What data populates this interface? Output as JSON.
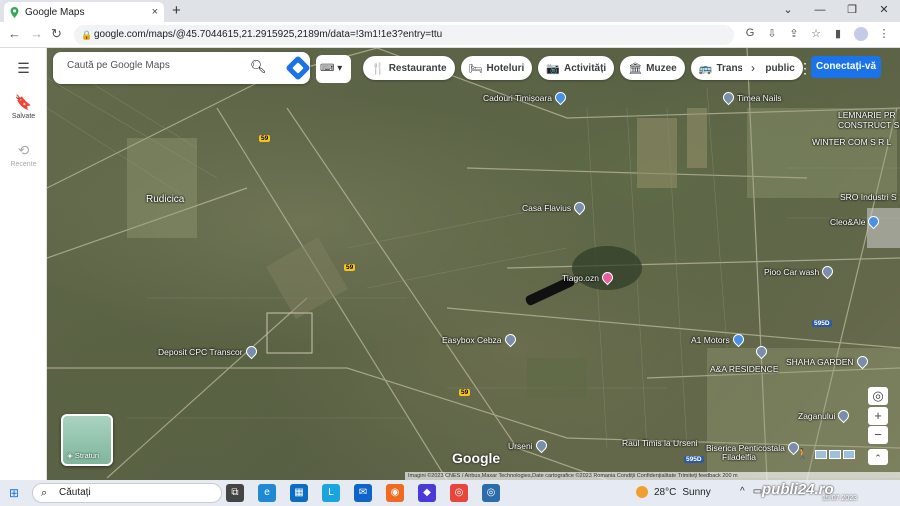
{
  "browser": {
    "tab_title": "Google Maps",
    "close_tab": "×",
    "new_tab": "+",
    "url": "google.com/maps/@45.7044615,21.2915925,2189m/data=!3m1!1e3?entry=ttu"
  },
  "sidebar": {
    "saved_label": "Salvate",
    "recent_label": "Recente"
  },
  "search": {
    "placeholder": "Caută pe Google Maps"
  },
  "chips": [
    {
      "icon": "🍴",
      "label": "Restaurante"
    },
    {
      "icon": "🛏",
      "label": "Hoteluri"
    },
    {
      "icon": "📷",
      "label": "Activități"
    },
    {
      "icon": "🏛",
      "label": "Muzee"
    },
    {
      "icon": "🚌",
      "label": "Transport public"
    }
  ],
  "sign_in_label": "Conectați-vă",
  "places": {
    "cadouri": "Cadouri Timișoara",
    "timea": "Timea Nails",
    "lemnarie": "LEMNARIE PR",
    "construct": "CONSTRUCT S",
    "winter": "WINTER COM S R L",
    "sro": "SRO Industri S",
    "cleo": "Cleo&Ale",
    "rudicica": "Rudicica",
    "casa_flavius": "Casa Flavius",
    "tiago": "Tiago.ozn",
    "pioo": "Pioo Car wash",
    "easybox": "Easybox Cebza",
    "a1motors": "A1 Motors",
    "shaha": "SHAHA GARDEN",
    "aa_residence": "A&A RESIDENCE",
    "deposit": "Deposit CPC Transcor",
    "zaganului": "Zaganului",
    "ursen": "Urseni",
    "raul": "Raul Timis la Urseni",
    "biserica": "Biserica Penticostala",
    "filadelfia": "Filadelfia"
  },
  "road_labels": {
    "r59a": "59",
    "r59b": "59",
    "r59c": "59",
    "r595d": "595D",
    "r595d_b": "595D"
  },
  "layers_label": "Straturi",
  "map_brand": "Google",
  "attribution": "Imagini ©2023 CNES / Airbus,Maxar Technologies,Date cartografice ©2023   Romania   Condiții   Confidențialitate   Trimiteți feedback   200 m",
  "taskbar": {
    "search_placeholder": "Căutați",
    "weather_temp": "28°C",
    "weather_text": "Sunny"
  },
  "watermark": {
    "brand": "publi24.ro",
    "date": "15.07.2023"
  }
}
